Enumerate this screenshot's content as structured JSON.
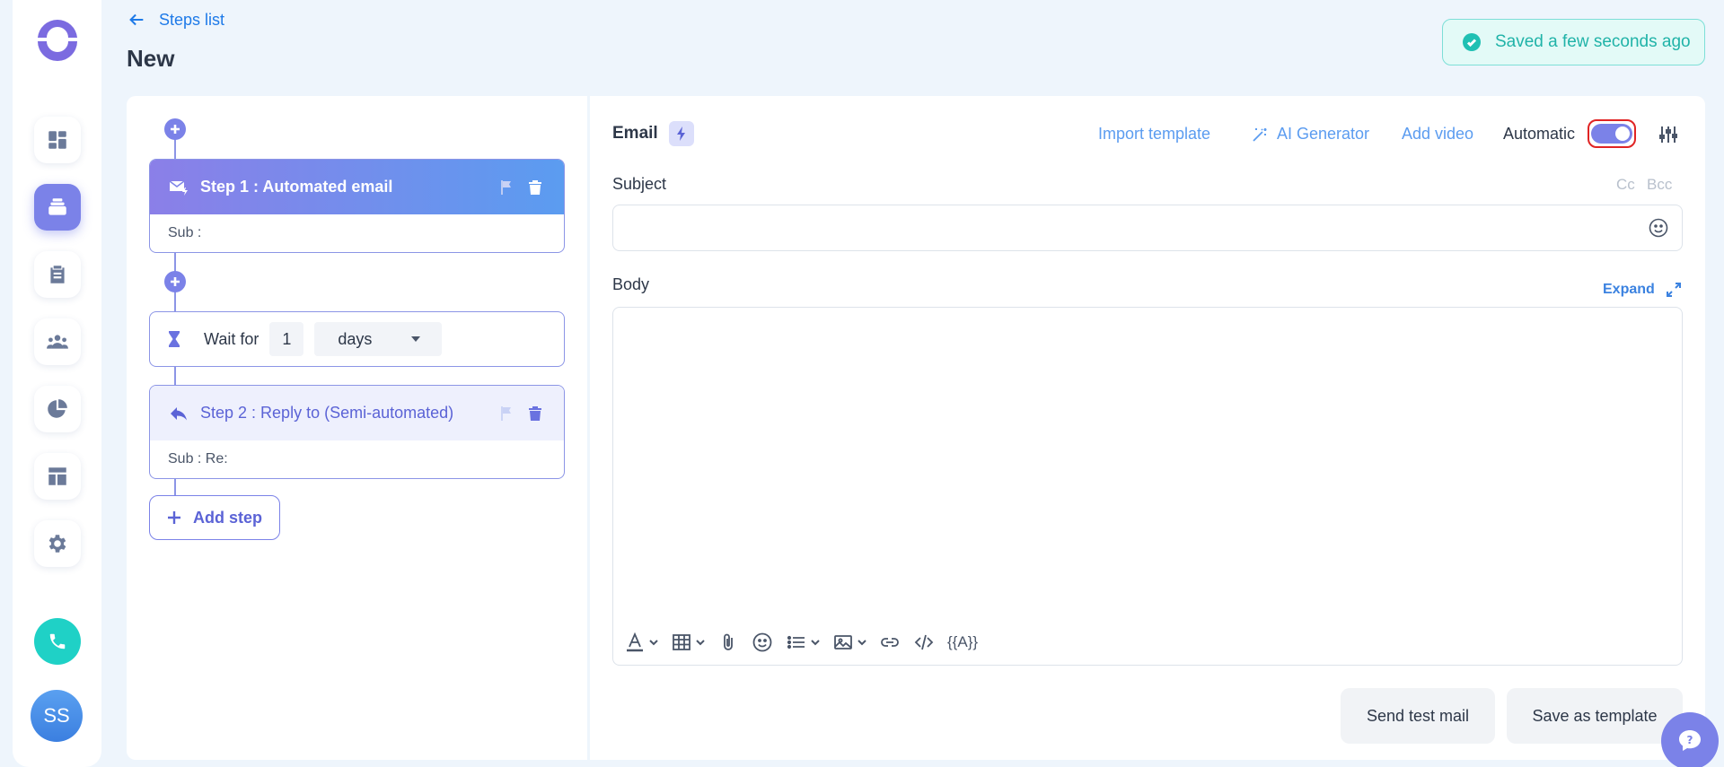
{
  "sidebar": {
    "items": [
      {
        "name": "dashboard"
      },
      {
        "name": "sequences",
        "active": true
      },
      {
        "name": "tasks"
      },
      {
        "name": "contacts"
      },
      {
        "name": "reports"
      },
      {
        "name": "templates"
      },
      {
        "name": "settings"
      }
    ],
    "avatar_initials": "SS"
  },
  "header": {
    "back_label": "Steps list",
    "title": "New",
    "saved_status": "Saved a few seconds ago"
  },
  "steps": {
    "step1": {
      "title": "Step 1 : Automated email",
      "sub": "Sub :"
    },
    "wait": {
      "label": "Wait for",
      "value": "1",
      "unit": "days"
    },
    "step2": {
      "title": "Step 2 : Reply to (Semi-automated)",
      "sub": "Sub : Re:"
    },
    "add_step_label": "Add step"
  },
  "editor": {
    "title": "Email",
    "toolbar": {
      "import_template": "Import template",
      "ai_generator": "AI Generator",
      "add_video": "Add video",
      "automatic_label": "Automatic",
      "automatic_on": true
    },
    "subject_label": "Subject",
    "cc": "Cc",
    "bcc": "Bcc",
    "body_label": "Body",
    "expand_label": "Expand",
    "variable_token": "{{A}}",
    "send_test": "Send test mail",
    "save_template": "Save as template"
  },
  "colors": {
    "accent": "#7b82e8",
    "link": "#5b9cf0",
    "success": "#20b3a8",
    "background": "#eef5fc"
  }
}
